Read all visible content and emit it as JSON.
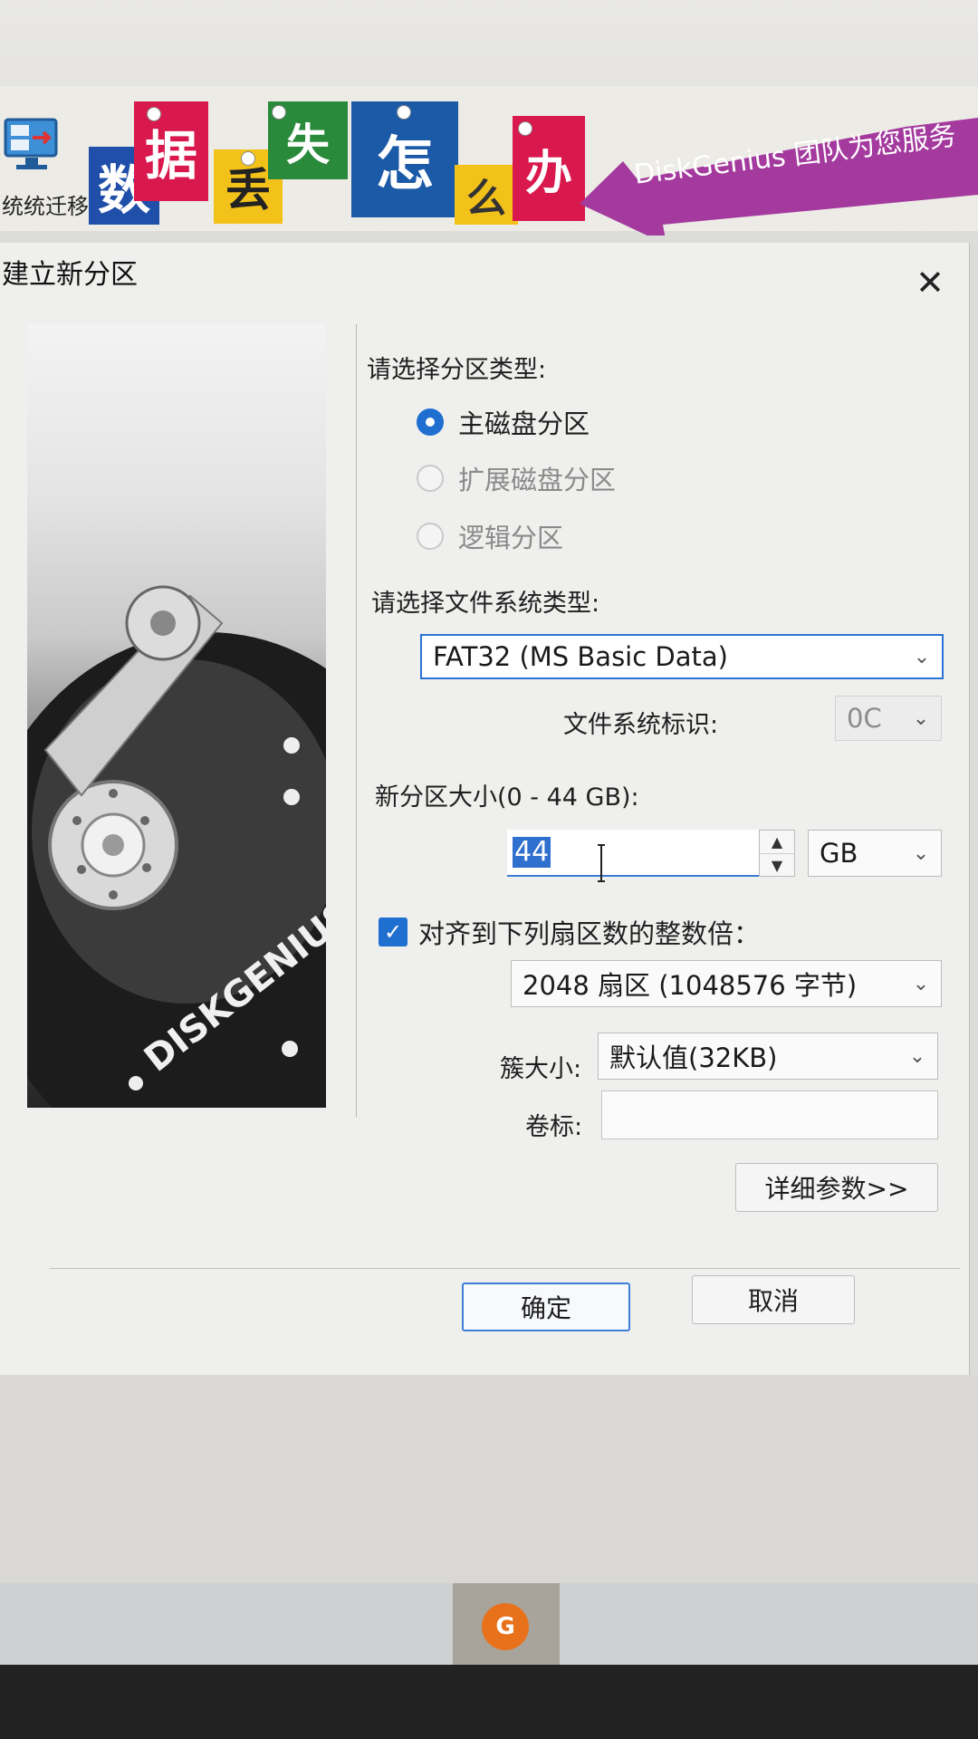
{
  "banner": {
    "migrate_label": "统统迁移",
    "ad_chars": [
      "数",
      "据",
      "丢",
      "失",
      "怎",
      "么",
      "办",
      "！"
    ],
    "ad_slogan": "DiskGenius 团队为您服务"
  },
  "dialog": {
    "title": "建立新分区",
    "close_symbol": "✕",
    "side_brand": "DISKGENIUS",
    "partition_type_label": "请选择分区类型:",
    "partition_types": [
      {
        "label": "主磁盘分区",
        "checked": true,
        "enabled": true
      },
      {
        "label": "扩展磁盘分区",
        "checked": false,
        "enabled": false
      },
      {
        "label": "逻辑分区",
        "checked": false,
        "enabled": false
      }
    ],
    "fs_type_label": "请选择文件系统类型:",
    "fs_type_value": "FAT32 (MS Basic Data)",
    "fs_id_label": "文件系统标识:",
    "fs_id_value": "0C",
    "size_label": "新分区大小(0 - 44 GB):",
    "size_value": "44",
    "size_unit": "GB",
    "align_label": "对齐到下列扇区数的整数倍：",
    "align_checked": true,
    "align_value": "2048 扇区 (1048576 字节)",
    "cluster_label": "簇大小:",
    "cluster_value": "默认值(32KB)",
    "volume_label": "卷标:",
    "volume_value": "",
    "details_button": "详细参数>>",
    "ok_button": "确定",
    "cancel_button": "取消"
  },
  "taskbar": {
    "app_icon": "diskgenius-app-icon"
  },
  "colors": {
    "accent": "#1f6fd1",
    "ad_arrow": "#a43a9e"
  }
}
